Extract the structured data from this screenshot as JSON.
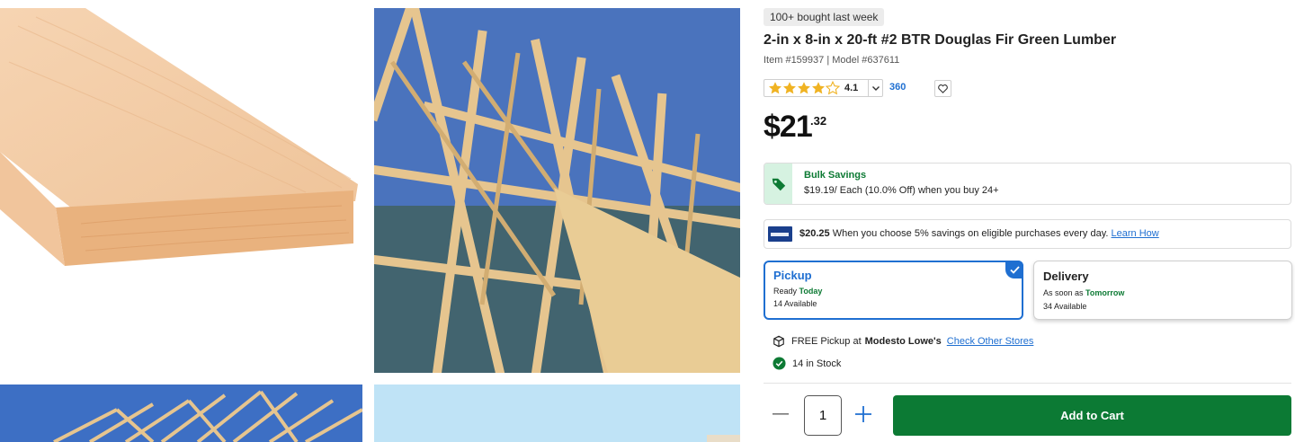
{
  "gallery": {
    "images": [
      {
        "name": "product-image-board"
      },
      {
        "name": "product-image-truss-framing"
      },
      {
        "name": "product-image-roof-truss-sky"
      },
      {
        "name": "product-image-sky"
      }
    ]
  },
  "product": {
    "badge": "100+ bought last week",
    "title": "2-in x 8-in x 20-ft #2 BTR Douglas Fir Green Lumber",
    "ids": "Item #159937 | Model #637611",
    "rating": {
      "value": "4.1",
      "stars": 4.1,
      "max": 5,
      "reviews": "360"
    },
    "price": {
      "dollars": "$21",
      "cents": ".32"
    }
  },
  "bulk": {
    "icon": "tag-icon",
    "title": "Bulk Savings",
    "text": "$19.19/ Each (10.0% Off) when you buy 24+"
  },
  "card_promo": {
    "amount": "$20.25",
    "text": "When you choose 5% savings on eligible purchases every day.",
    "link": "Learn How"
  },
  "fulfillment": {
    "pickup": {
      "title": "Pickup",
      "ready_label": "Ready",
      "ready_value": "Today",
      "available": "14 Available",
      "selected": true
    },
    "delivery": {
      "title": "Delivery",
      "ready_label": "As soon as",
      "ready_value": "Tomorrow",
      "available": "34 Available"
    }
  },
  "pickup_info": {
    "prefix": "FREE Pickup at",
    "store": "Modesto Lowe's",
    "link": "Check Other Stores",
    "stock": "14 in Stock"
  },
  "cart": {
    "quantity": "1",
    "button": "Add to Cart"
  },
  "colors": {
    "accent_blue": "#1f6fd1",
    "cart_green": "#0c7a34",
    "savings_green": "#0d7a34",
    "star_gold": "#f0b323"
  }
}
